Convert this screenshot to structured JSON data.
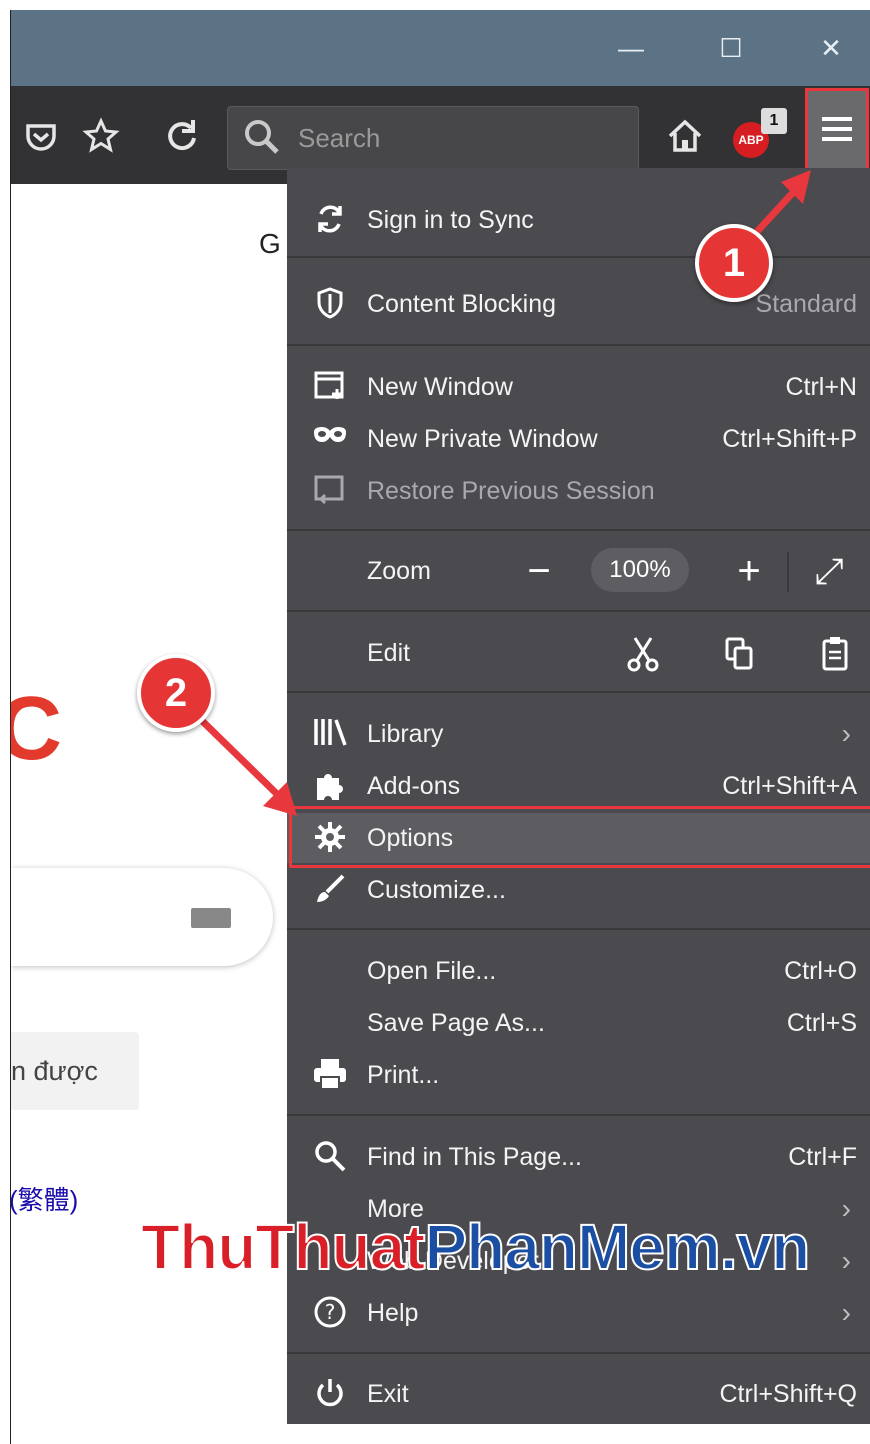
{
  "window": {
    "minimize": "—",
    "maximize": "☐",
    "close": "✕"
  },
  "toolbar": {
    "search_placeholder": "Search",
    "adblock_label": "ABP",
    "adblock_badge": "1",
    "menu_button": "Open menu"
  },
  "page": {
    "partial_heading": "G",
    "partial_button": "n được",
    "partial_link": "(繁體)"
  },
  "menu": {
    "sync": {
      "label": "Sign in to Sync"
    },
    "content_blocking": {
      "label": "Content Blocking",
      "value": "Standard"
    },
    "new_window": {
      "label": "New Window",
      "shortcut": "Ctrl+N"
    },
    "new_private_window": {
      "label": "New Private Window",
      "shortcut": "Ctrl+Shift+P"
    },
    "restore_session": {
      "label": "Restore Previous Session"
    },
    "zoom": {
      "label": "Zoom",
      "minus": "−",
      "value": "100%",
      "plus": "+",
      "fullscreen": "⤢"
    },
    "edit": {
      "label": "Edit"
    },
    "library": {
      "label": "Library"
    },
    "addons": {
      "label": "Add-ons",
      "shortcut": "Ctrl+Shift+A"
    },
    "options": {
      "label": "Options"
    },
    "customize": {
      "label": "Customize..."
    },
    "open_file": {
      "label": "Open File...",
      "shortcut": "Ctrl+O"
    },
    "save_page": {
      "label": "Save Page As...",
      "shortcut": "Ctrl+S"
    },
    "print": {
      "label": "Print..."
    },
    "find": {
      "label": "Find in This Page...",
      "shortcut": "Ctrl+F"
    },
    "more": {
      "label": "More"
    },
    "web_developer": {
      "label": "Web Developer"
    },
    "help": {
      "label": "Help"
    },
    "exit": {
      "label": "Exit",
      "shortcut": "Ctrl+Shift+Q"
    }
  },
  "annotations": {
    "step1": "1",
    "step2": "2"
  },
  "watermark": {
    "part1": "ThuThuat",
    "part2": "PhanMem.vn"
  },
  "colors": {
    "accent_red": "#e8383d",
    "menu_bg": "#4a4a4f",
    "titlebar": "#5b7385",
    "toolbar": "#323234"
  }
}
